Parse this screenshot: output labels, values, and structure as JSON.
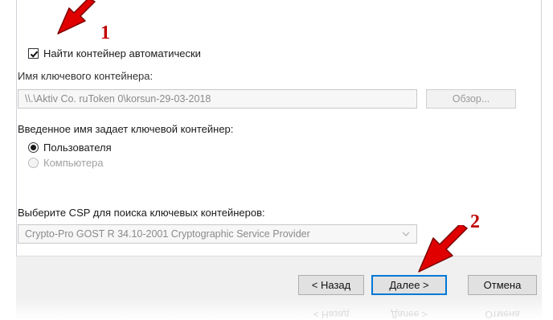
{
  "auto_find": {
    "label": "Найти контейнер автоматически",
    "checked": true
  },
  "container": {
    "label": "Имя ключевого контейнера:",
    "value": "\\\\.\\Aktiv Co. ruToken 0\\korsun-29-03-2018",
    "browse_label": "Обзор..."
  },
  "owner": {
    "label": "Введенное имя задает ключевой контейнер:",
    "options": [
      {
        "label": "Пользователя",
        "selected": true,
        "enabled": true
      },
      {
        "label": "Компьютера",
        "selected": false,
        "enabled": false
      }
    ]
  },
  "csp": {
    "label": "Выберите CSP для поиска ключевых контейнеров:",
    "value": "Crypto-Pro GOST R 34.10-2001 Cryptographic Service Provider"
  },
  "buttons": {
    "back": "< Назад",
    "next": "Далее >",
    "cancel": "Отмена"
  },
  "annotations": {
    "marker1": "1",
    "marker2": "2",
    "arrow_color": "#e00000"
  },
  "colors": {
    "focus_border": "#0078d7",
    "disabled_text": "#8a8a8a"
  }
}
